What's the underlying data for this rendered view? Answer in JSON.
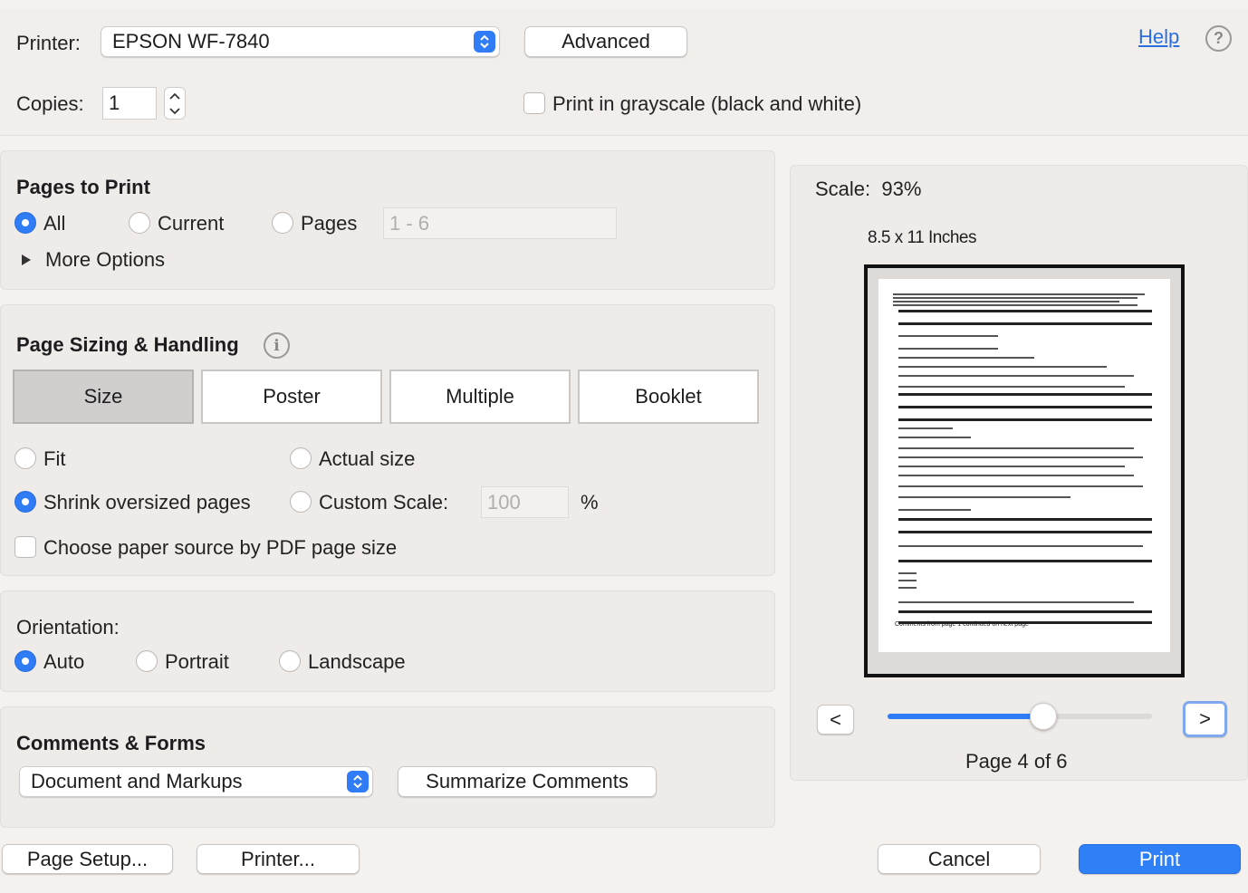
{
  "top": {
    "printer_label": "Printer:",
    "printer_value": "EPSON WF-7840",
    "advanced_label": "Advanced",
    "help_label": "Help",
    "copies_label": "Copies:",
    "copies_value": "1",
    "grayscale_label": "Print in grayscale (black and white)"
  },
  "pages_to_print": {
    "title": "Pages to Print",
    "all_label": "All",
    "current_label": "Current",
    "pages_label": "Pages",
    "pages_placeholder": "1 - 6",
    "more_options_label": "More Options",
    "selected": "All"
  },
  "sizing": {
    "title": "Page Sizing & Handling",
    "tabs": [
      "Size",
      "Poster",
      "Multiple",
      "Booklet"
    ],
    "active_tab": "Size",
    "fit_label": "Fit",
    "actual_size_label": "Actual size",
    "shrink_label": "Shrink oversized pages",
    "custom_scale_label": "Custom Scale:",
    "custom_scale_value": "100",
    "percent_label": "%",
    "paper_source_label": "Choose paper source by PDF page size",
    "selected": "Shrink oversized pages"
  },
  "orientation": {
    "title": "Orientation:",
    "auto_label": "Auto",
    "portrait_label": "Portrait",
    "landscape_label": "Landscape",
    "selected": "Auto"
  },
  "comments": {
    "title": "Comments & Forms",
    "select_value": "Document and Markups",
    "summarize_label": "Summarize Comments"
  },
  "preview": {
    "scale_label": "Scale:",
    "scale_value": "93%",
    "paper_size": "8.5 x 11 Inches",
    "prev_label": "<",
    "next_label": ">",
    "page_indicator": "Page 4 of 6",
    "slider_fraction": 0.59,
    "footer_note": "Comments from page 1 continued on next page"
  },
  "footer": {
    "page_setup_label": "Page Setup...",
    "printer_label": "Printer...",
    "cancel_label": "Cancel",
    "print_label": "Print"
  },
  "colors": {
    "accent": "#2f7cf6",
    "background": "#f4f1ef",
    "panel": "#efebe9",
    "help_link": "#2a6fe0"
  }
}
